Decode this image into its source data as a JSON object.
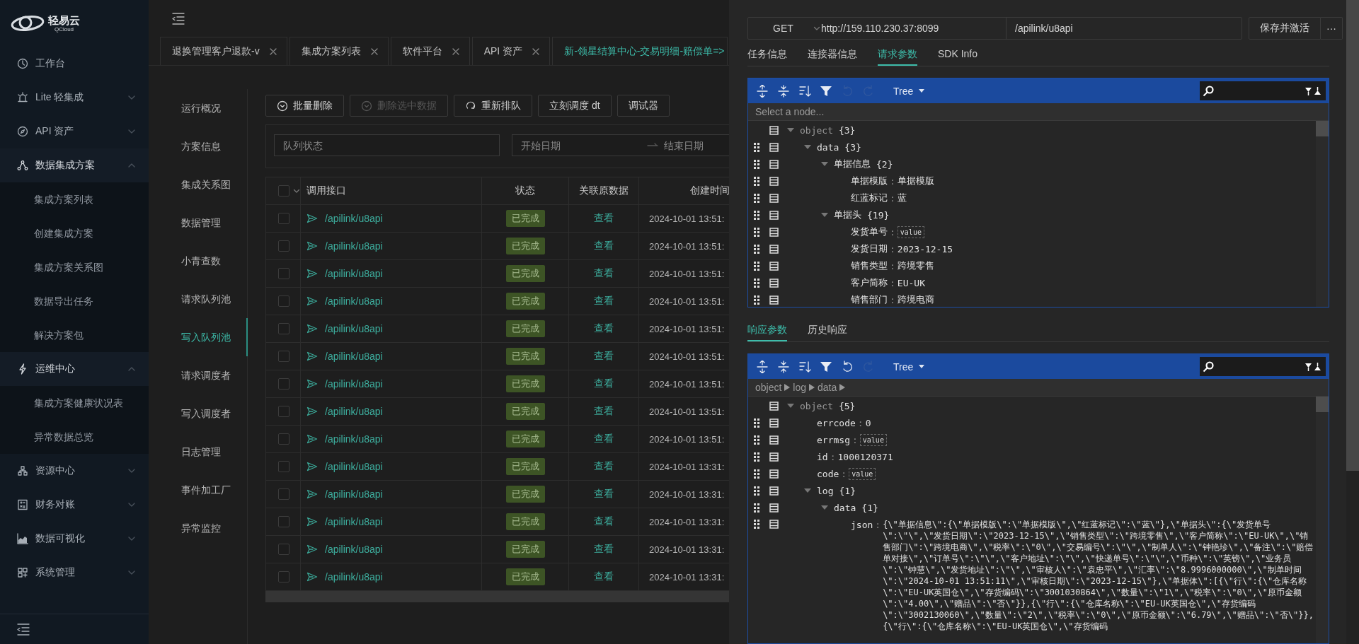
{
  "sidebar": {
    "logo": {
      "name": "轻易云",
      "tagline": "QCloud"
    },
    "items": [
      {
        "label": "工作台"
      },
      {
        "label": "Lite 轻集成",
        "expanded": false
      },
      {
        "label": "API 资产",
        "expanded": false
      },
      {
        "label": "数据集成方案",
        "expanded": true,
        "children": [
          {
            "label": "集成方案列表"
          },
          {
            "label": "创建集成方案"
          },
          {
            "label": "集成方案关系图"
          },
          {
            "label": "数据导出任务"
          },
          {
            "label": "解决方案包"
          }
        ]
      },
      {
        "label": "运维中心",
        "expanded": true,
        "children": [
          {
            "label": "集成方案健康状况表"
          },
          {
            "label": "异常数据总览"
          }
        ]
      },
      {
        "label": "资源中心",
        "expanded": false
      },
      {
        "label": "财务对账",
        "expanded": false
      },
      {
        "label": "数据可视化",
        "expanded": false
      },
      {
        "label": "系统管理",
        "expanded": false
      }
    ]
  },
  "tabs": [
    {
      "label": "退换管理客户退款-v",
      "selected": false,
      "closable": true
    },
    {
      "label": "集成方案列表",
      "selected": false,
      "closable": true
    },
    {
      "label": "软件平台",
      "selected": false,
      "closable": true
    },
    {
      "label": "API 资产",
      "selected": false,
      "closable": true
    },
    {
      "label": "新-领星结算中心-交易明细-赔偿单=>",
      "selected": true,
      "closable": false
    }
  ],
  "subnav": [
    {
      "label": "运行概况",
      "selected": false
    },
    {
      "label": "方案信息",
      "selected": false
    },
    {
      "label": "集成关系图",
      "selected": false
    },
    {
      "label": "数据管理",
      "selected": false
    },
    {
      "label": "小青查数",
      "selected": false
    },
    {
      "label": "请求队列池",
      "selected": false
    },
    {
      "label": "写入队列池",
      "selected": true
    },
    {
      "label": "请求调度者",
      "selected": false
    },
    {
      "label": "写入调度者",
      "selected": false
    },
    {
      "label": "日志管理",
      "selected": false
    },
    {
      "label": "事件加工厂",
      "selected": false
    },
    {
      "label": "异常监控",
      "selected": false
    }
  ],
  "toolbar": [
    {
      "label": "批量删除",
      "disabled": false
    },
    {
      "label": "删除选中数据",
      "disabled": true
    },
    {
      "label": "重新排队",
      "disabled": false
    },
    {
      "label": "立刻调度 dt",
      "disabled": false
    },
    {
      "label": "调试器",
      "disabled": false
    }
  ],
  "filters": {
    "status": {
      "placeholder": "队列状态"
    },
    "date_range": {
      "start_placeholder": "开始日期",
      "end_placeholder": "结束日期"
    }
  },
  "table": {
    "header_checked": false,
    "columns": [
      "调用接口",
      "状态",
      "关联原数据",
      "创建时间"
    ],
    "rows": [
      {
        "checked": false,
        "api": "/apilink/u8api",
        "status": "已完成",
        "link": "查看",
        "created": "2024-10-01 13:51:"
      },
      {
        "checked": false,
        "api": "/apilink/u8api",
        "status": "已完成",
        "link": "查看",
        "created": "2024-10-01 13:51:"
      },
      {
        "checked": false,
        "api": "/apilink/u8api",
        "status": "已完成",
        "link": "查看",
        "created": "2024-10-01 13:51:"
      },
      {
        "checked": false,
        "api": "/apilink/u8api",
        "status": "已完成",
        "link": "查看",
        "created": "2024-10-01 13:51:"
      },
      {
        "checked": false,
        "api": "/apilink/u8api",
        "status": "已完成",
        "link": "查看",
        "created": "2024-10-01 13:51:"
      },
      {
        "checked": false,
        "api": "/apilink/u8api",
        "status": "已完成",
        "link": "查看",
        "created": "2024-10-01 13:51:"
      },
      {
        "checked": false,
        "api": "/apilink/u8api",
        "status": "已完成",
        "link": "查看",
        "created": "2024-10-01 13:51:"
      },
      {
        "checked": false,
        "api": "/apilink/u8api",
        "status": "已完成",
        "link": "查看",
        "created": "2024-10-01 13:51:"
      },
      {
        "checked": false,
        "api": "/apilink/u8api",
        "status": "已完成",
        "link": "查看",
        "created": "2024-10-01 13:51:"
      },
      {
        "checked": false,
        "api": "/apilink/u8api",
        "status": "已完成",
        "link": "查看",
        "created": "2024-10-01 13:31:"
      },
      {
        "checked": false,
        "api": "/apilink/u8api",
        "status": "已完成",
        "link": "查看",
        "created": "2024-10-01 13:31:"
      },
      {
        "checked": false,
        "api": "/apilink/u8api",
        "status": "已完成",
        "link": "查看",
        "created": "2024-10-01 13:31:"
      },
      {
        "checked": false,
        "api": "/apilink/u8api",
        "status": "已完成",
        "link": "查看",
        "created": "2024-10-01 13:31:"
      },
      {
        "checked": false,
        "api": "/apilink/u8api",
        "status": "已完成",
        "link": "查看",
        "created": "2024-10-01 13:31:"
      }
    ]
  },
  "drawer": {
    "method": "GET",
    "base_url": "http://159.110.230.37:8099",
    "path": "/apilink/u8api",
    "save_button": "保存并激活",
    "more_button": "···",
    "tabs": [
      {
        "label": "任务信息",
        "selected": false
      },
      {
        "label": "连接器信息",
        "selected": false
      },
      {
        "label": "请求参数",
        "selected": true
      },
      {
        "label": "SDK Info",
        "selected": false
      }
    ],
    "request_editor": {
      "mode": "Tree",
      "undo_enabled": false,
      "redo_enabled": false,
      "navigation_hint": "Select a node...",
      "separator": ":",
      "tree": {
        "key": "object",
        "count": "{3}",
        "expanded": true,
        "children": [
          {
            "key": "data",
            "count": "{3}",
            "expanded": true,
            "children": [
              {
                "key": "单据信息",
                "count": "{2}",
                "expanded": true,
                "children": [
                  {
                    "key": "单据模版",
                    "value": "单据模版"
                  },
                  {
                    "key": "红蓝标记",
                    "value": "蓝"
                  }
                ]
              },
              {
                "key": "单据头",
                "count": "{19}",
                "expanded": true,
                "children": [
                  {
                    "key": "发货单号",
                    "placeholder": "value"
                  },
                  {
                    "key": "发货日期",
                    "value": "2023-12-15"
                  },
                  {
                    "key": "销售类型",
                    "value": "跨境零售"
                  },
                  {
                    "key": "客户简称",
                    "value": "EU-UK"
                  },
                  {
                    "key": "销售部门",
                    "value": "跨境电商"
                  }
                ]
              }
            ]
          }
        ]
      }
    },
    "response_tabs": [
      {
        "label": "响应参数",
        "selected": true
      },
      {
        "label": "历史响应",
        "selected": false
      }
    ],
    "response_editor": {
      "mode": "Tree",
      "undo_enabled": true,
      "redo_enabled": false,
      "breadcrumb": [
        "object",
        "log",
        "data"
      ],
      "separator": ":",
      "tree": {
        "key": "object",
        "count": "{5}",
        "expanded": true,
        "children": [
          {
            "key": "errcode",
            "value": "0"
          },
          {
            "key": "errmsg",
            "placeholder": "value"
          },
          {
            "key": "id",
            "value": "1000120371"
          },
          {
            "key": "code",
            "placeholder": "value"
          },
          {
            "key": "log",
            "count": "{1}",
            "expanded": true,
            "children": [
              {
                "key": "data",
                "count": "{1}",
                "expanded": true,
                "children": [
                  {
                    "key": "json",
                    "value": "{\\\"单据信息\\\":{\\\"单据模版\\\":\\\"单据模版\\\",\\\"红蓝标记\\\":\\\"蓝\\\"},\\\"单据头\\\":{\\\"发货单号\\\":\\\"\\\",\\\"发货日期\\\":\\\"2023-12-15\\\",\\\"销售类型\\\":\\\"跨境零售\\\",\\\"客户简称\\\":\\\"EU-UK\\\",\\\"销售部门\\\":\\\"跨境电商\\\",\\\"税率\\\":\\\"0\\\",\\\"交易编号\\\":\\\"\\\",\\\"制单人\\\":\\\"钟艳珍\\\",\\\"备注\\\":\\\"赔偿单对接\\\",\\\"订单号\\\":\\\"\\\",\\\"客户地址\\\":\\\"\\\",\\\"快递单号\\\":\\\"\\\",\\\"币种\\\":\\\"英镑\\\",\\\"业务员\\\":\\\"钟慧\\\",\\\"发货地址\\\":\\\"\\\",\\\"审核人\\\":\\\"袁忠平\\\",\\\"汇率\\\":\\\"8.9996000000\\\",\\\"制单时间\\\":\\\"2024-10-01 13:51:11\\\",\\\"审核日期\\\":\\\"2023-12-15\\\"},\\\"单据体\\\":[{\\\"行\\\":{\\\"仓库名称\\\":\\\"EU-UK英国仓\\\",\\\"存货编码\\\":\\\"3001030864\\\",\\\"数量\\\":\\\"1\\\",\\\"税率\\\":\\\"0\\\",\\\"原币金额\\\":\\\"4.00\\\",\\\"赠品\\\":\\\"否\\\"}},{\\\"行\\\":{\\\"仓库名称\\\":\\\"EU-UK英国仓\\\",\\\"存货编码\\\":\\\"3002130060\\\",\\\"数量\\\":\\\"2\\\",\\\"税率\\\":\\\"0\\\",\\\"原币金额\\\":\\\"6.79\\\",\\\"赠品\\\":\\\"否\\\"}},{\\\"行\\\":{\\\"仓库名称\\\":\\\"EU-UK英国仓\\\",\\\"存货编码"
                  }
                ]
              }
            ]
          }
        ]
      }
    }
  }
}
